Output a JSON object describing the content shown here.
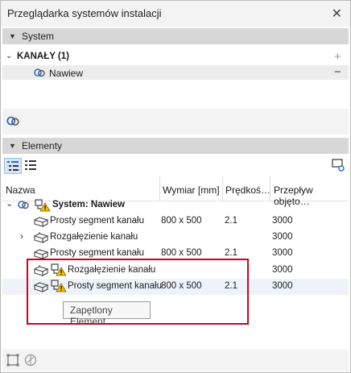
{
  "window": {
    "title": "Przeglądarka systemów instalacji",
    "close": "✕"
  },
  "system_section": {
    "header": "System",
    "group_label": "KANAŁY (1)",
    "add_symbol": "+",
    "item_label": "Nawiew",
    "remove_symbol": "−"
  },
  "elements_section": {
    "header": "Elementy"
  },
  "table": {
    "columns": [
      "Nazwa",
      "Wymiar [mm]",
      "Prędkoś…",
      "Przepływ objęto…"
    ],
    "rows": [
      {
        "name": "System: Nawiew",
        "dim": "",
        "speed": "",
        "flow": ""
      },
      {
        "name": "Prosty segment kanału",
        "dim": "800 x 500",
        "speed": "2.1",
        "flow": "3000"
      },
      {
        "name": "Rozgałęzienie kanału",
        "dim": "",
        "speed": "",
        "flow": "3000"
      },
      {
        "name": "Prosty segment kanału",
        "dim": "800 x 500",
        "speed": "2.1",
        "flow": "3000"
      },
      {
        "name": "Rozgałęzienie kanału",
        "dim": "",
        "speed": "",
        "flow": "3000"
      },
      {
        "name": "Prosty segment kanału",
        "dim": "800 x 500",
        "speed": "2.1",
        "flow": "3000"
      }
    ]
  },
  "tooltip": "Zapętlony Element",
  "colors": {
    "accent": "#2a6fc9",
    "warning": "#f2c200",
    "highlight": "#d0021b"
  }
}
